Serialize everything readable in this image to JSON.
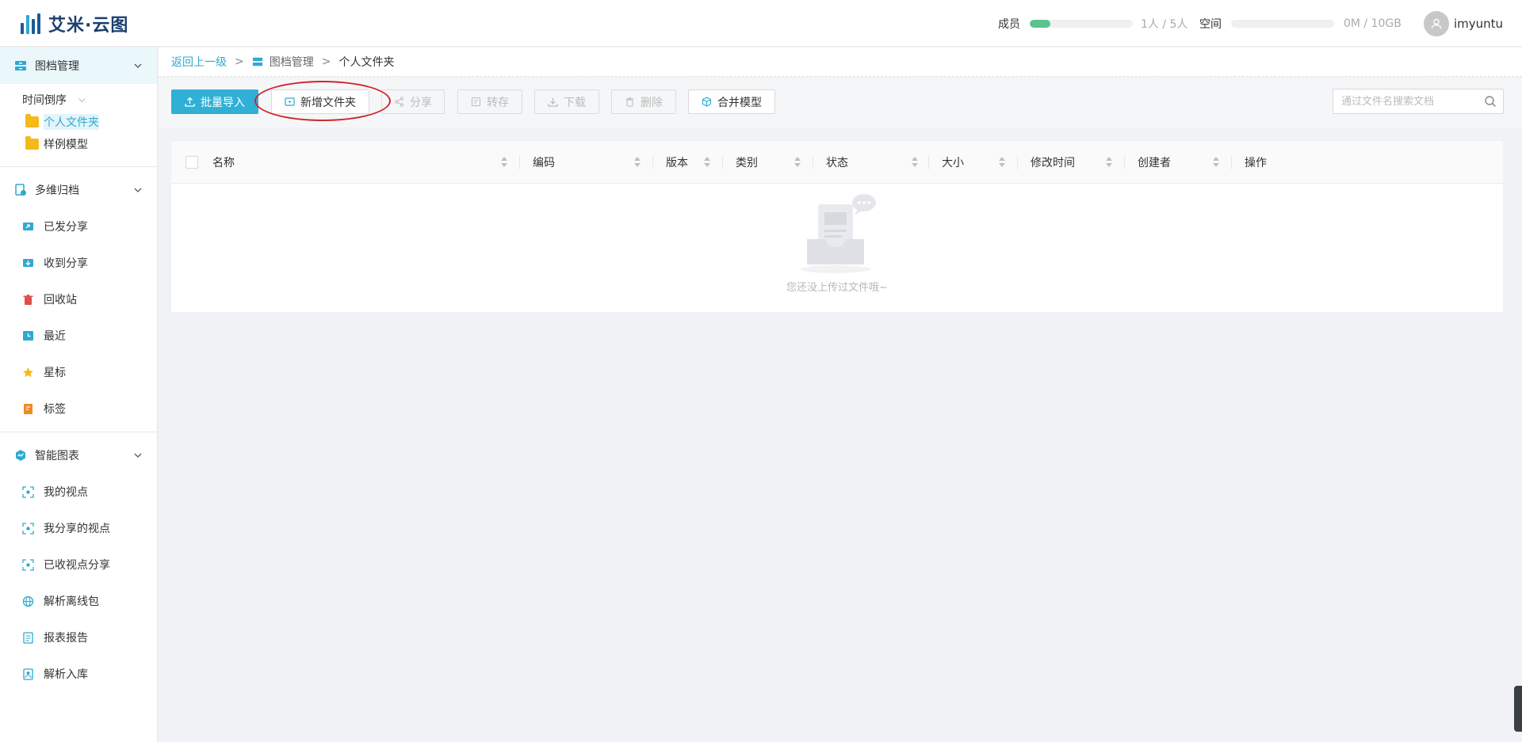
{
  "header": {
    "brand": "艾米·云图",
    "members_label": "成员",
    "members_value": "1人 / 5人",
    "members_fraction": 0.2,
    "space_label": "空间",
    "space_value": "0M / 10GB",
    "space_fraction": 0,
    "username": "imyuntu"
  },
  "sidebar": {
    "archive_title": "图档管理",
    "sort_label": "时间倒序",
    "folders": [
      {
        "label": "个人文件夹",
        "selected": true
      },
      {
        "label": "样例模型",
        "selected": false
      }
    ],
    "multi_title": "多维归档",
    "multi_items": [
      {
        "label": "已发分享",
        "icon": "share-out-icon"
      },
      {
        "label": "收到分享",
        "icon": "share-in-icon"
      },
      {
        "label": "回收站",
        "icon": "trash-icon"
      },
      {
        "label": "最近",
        "icon": "clock-icon"
      },
      {
        "label": "星标",
        "icon": "star-icon"
      },
      {
        "label": "标签",
        "icon": "tag-icon"
      }
    ],
    "smart_title": "智能图表",
    "smart_items": [
      {
        "label": "我的视点",
        "icon": "viewpoint-icon"
      },
      {
        "label": "我分享的视点",
        "icon": "viewpoint-icon"
      },
      {
        "label": "已收视点分享",
        "icon": "viewpoint-icon"
      },
      {
        "label": "解析离线包",
        "icon": "globe-icon"
      },
      {
        "label": "报表报告",
        "icon": "report-icon"
      },
      {
        "label": "解析入库",
        "icon": "import-icon"
      }
    ]
  },
  "breadcrumb": {
    "back": "返回上一级",
    "sep": ">",
    "parent": "图档管理",
    "current": "个人文件夹"
  },
  "toolbar": {
    "import": "批量导入",
    "new_folder": "新增文件夹",
    "share": "分享",
    "transfer": "转存",
    "download": "下载",
    "delete": "删除",
    "merge": "合并模型",
    "search_placeholder": "通过文件名搜索文档"
  },
  "table": {
    "columns": [
      "名称",
      "编码",
      "版本",
      "类别",
      "状态",
      "大小",
      "修改时间",
      "创建者",
      "操作"
    ],
    "empty_text": "您还没上传过文件哦~"
  },
  "colors": {
    "accent": "#2fb0d6",
    "progress": "#5cc28e",
    "annotation": "#d0252b"
  }
}
